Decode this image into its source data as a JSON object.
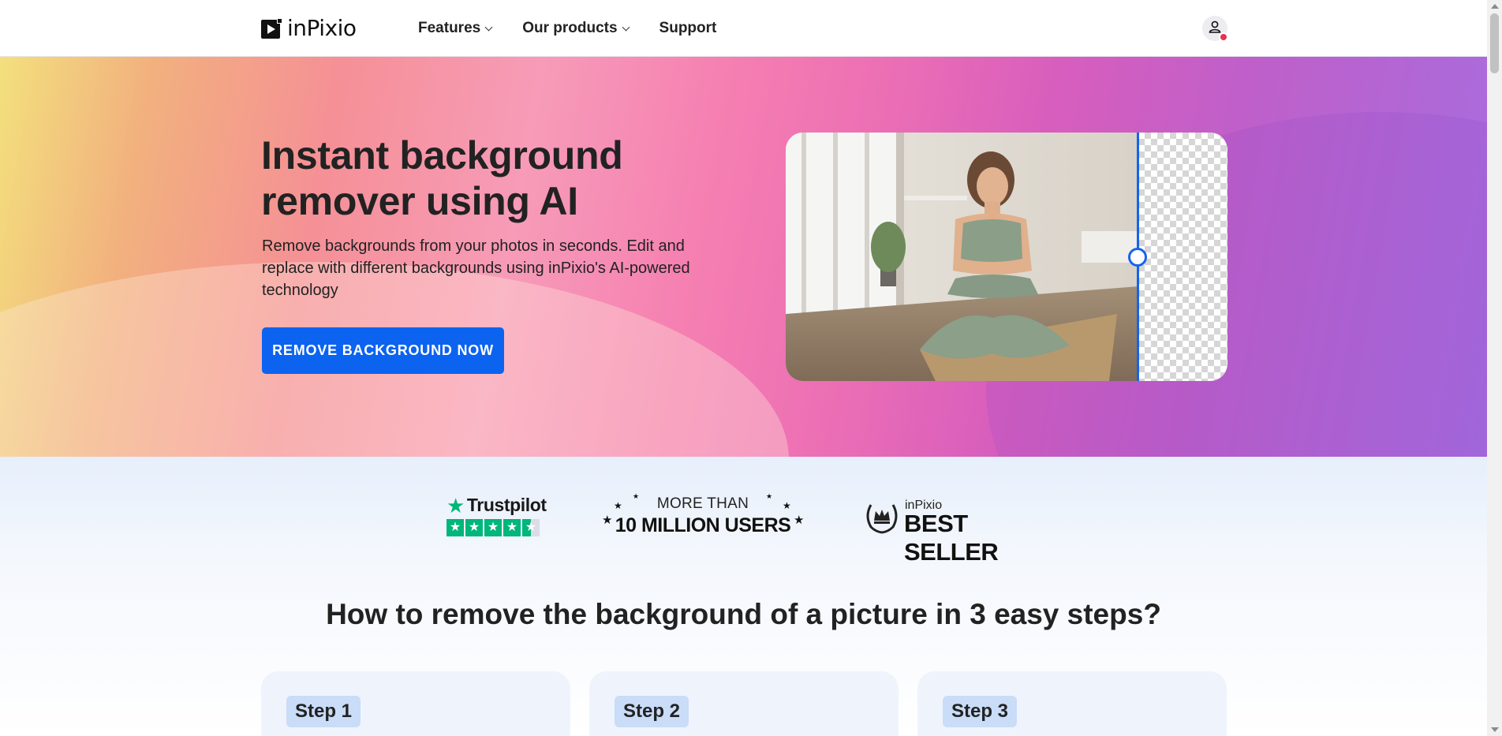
{
  "header": {
    "logo_text": "inPixio",
    "nav": [
      {
        "label": "Features",
        "has_dropdown": true
      },
      {
        "label": "Our products",
        "has_dropdown": true
      },
      {
        "label": "Support",
        "has_dropdown": false
      }
    ],
    "account_icon": "user-icon",
    "notification_color": "#e5344d"
  },
  "hero": {
    "title": "Instant background remover using AI",
    "subtitle": "Remove backgrounds from your photos in seconds. Edit and replace with different backgrounds using inPixio's AI-powered technology",
    "cta_label": "REMOVE BACKGROUND NOW",
    "cta_color": "#0c63f0",
    "compare_divider_color": "#1664e8",
    "compare_position_percent": 80
  },
  "badges": {
    "trustpilot": {
      "name": "Trustpilot",
      "stars": 4.5
    },
    "users": {
      "top": "MORE THAN",
      "main": "10 MILLION USERS"
    },
    "bestseller": {
      "brand": "inPixio",
      "label": "BEST SELLER"
    }
  },
  "steps": {
    "title": "How to remove the background of a picture in 3 easy steps?",
    "items": [
      {
        "label": "Step 1"
      },
      {
        "label": "Step 2"
      },
      {
        "label": "Step 3"
      }
    ]
  }
}
